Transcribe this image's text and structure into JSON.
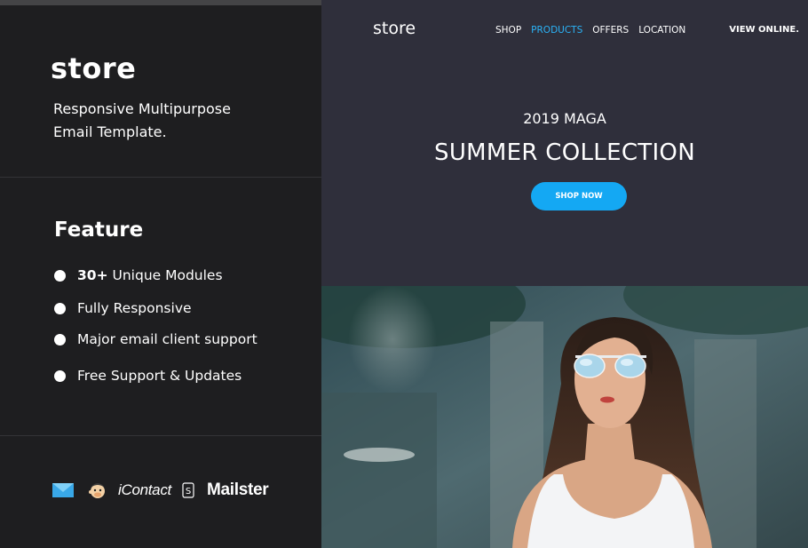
{
  "left": {
    "brand": "store",
    "tagline_line1": "Responsive Multipurpose",
    "tagline_line2": "Email Template.",
    "feature_title": "Feature",
    "features": [
      {
        "bold": "30+",
        "text": "Unique Modules"
      },
      {
        "bold": "",
        "text": "Fully Responsive"
      },
      {
        "bold": "",
        "text": "Major email client support"
      },
      {
        "bold": "",
        "text": "Free Support & Updates"
      }
    ],
    "logos": {
      "icontact": "iContact",
      "mailster": "Mailster",
      "icons": [
        "campaign-monitor-icon",
        "mailchimp-icon",
        "sendy-icon"
      ]
    }
  },
  "preview": {
    "brand": "store",
    "nav": [
      "SHOP",
      "PRODUCTS",
      "OFFERS",
      "LOCATION"
    ],
    "active_nav": "PRODUCTS",
    "view_online": "VIEW ONLINE.",
    "eyebrow": "2019 MAGA",
    "headline": "SUMMER COLLECTION",
    "cta": "SHOP NOW"
  },
  "colors": {
    "left_bg": "#1e1e20",
    "hero_bg": "#2f2f3b",
    "accent": "#14a8f3",
    "active_nav": "#2bb3f7"
  }
}
